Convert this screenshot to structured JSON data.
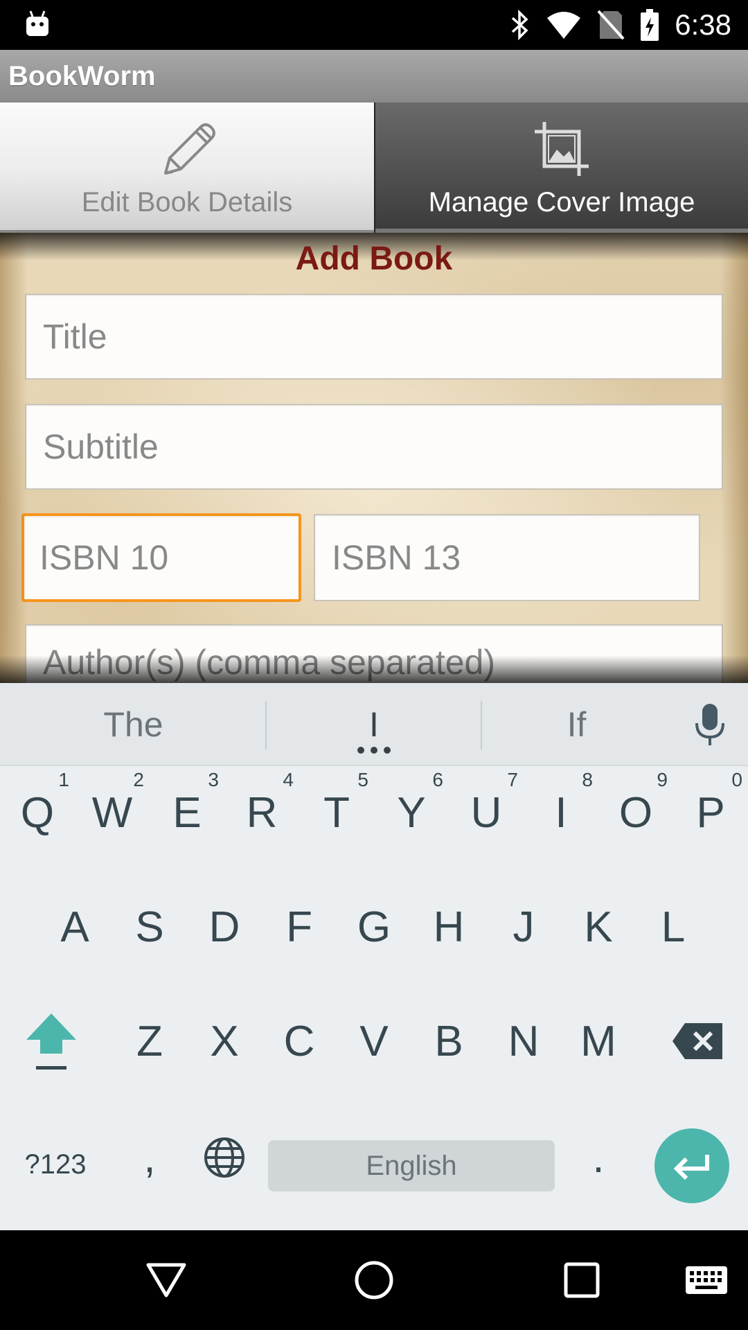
{
  "status_bar": {
    "time": "6:38",
    "icons": [
      "android-icon",
      "bluetooth-icon",
      "wifi-icon",
      "no-sim-icon",
      "battery-charging-icon"
    ]
  },
  "app_bar": {
    "title": "BookWorm"
  },
  "tabs": [
    {
      "label": "Edit Book Details",
      "icon": "pencil-icon",
      "selected": true
    },
    {
      "label": "Manage Cover Image",
      "icon": "crop-image-icon",
      "selected": false
    }
  ],
  "form": {
    "title": "Add Book",
    "fields": {
      "title": {
        "placeholder": "Title",
        "value": ""
      },
      "subtitle": {
        "placeholder": "Subtitle",
        "value": ""
      },
      "isbn10": {
        "placeholder": "ISBN 10",
        "value": "",
        "focused": true
      },
      "isbn13": {
        "placeholder": "ISBN 13",
        "value": ""
      },
      "authors": {
        "placeholder": "Author(s) (comma separated)",
        "value": ""
      }
    }
  },
  "keyboard": {
    "suggestions": [
      "The",
      "I",
      "If"
    ],
    "row1": [
      {
        "label": "Q",
        "hint": "1"
      },
      {
        "label": "W",
        "hint": "2"
      },
      {
        "label": "E",
        "hint": "3"
      },
      {
        "label": "R",
        "hint": "4"
      },
      {
        "label": "T",
        "hint": "5"
      },
      {
        "label": "Y",
        "hint": "6"
      },
      {
        "label": "U",
        "hint": "7"
      },
      {
        "label": "I",
        "hint": "8"
      },
      {
        "label": "O",
        "hint": "9"
      },
      {
        "label": "P",
        "hint": "0"
      }
    ],
    "row2": [
      "A",
      "S",
      "D",
      "F",
      "G",
      "H",
      "J",
      "K",
      "L"
    ],
    "row3": [
      "Z",
      "X",
      "C",
      "V",
      "B",
      "N",
      "M"
    ],
    "symbols_label": "?123",
    "comma_label": ",",
    "space_label": "English",
    "period_label": ".",
    "accent_color": "#4db6ac"
  },
  "nav_bar": {
    "icons": [
      "back-icon",
      "home-icon",
      "recents-icon",
      "keyboard-switch-icon"
    ]
  }
}
